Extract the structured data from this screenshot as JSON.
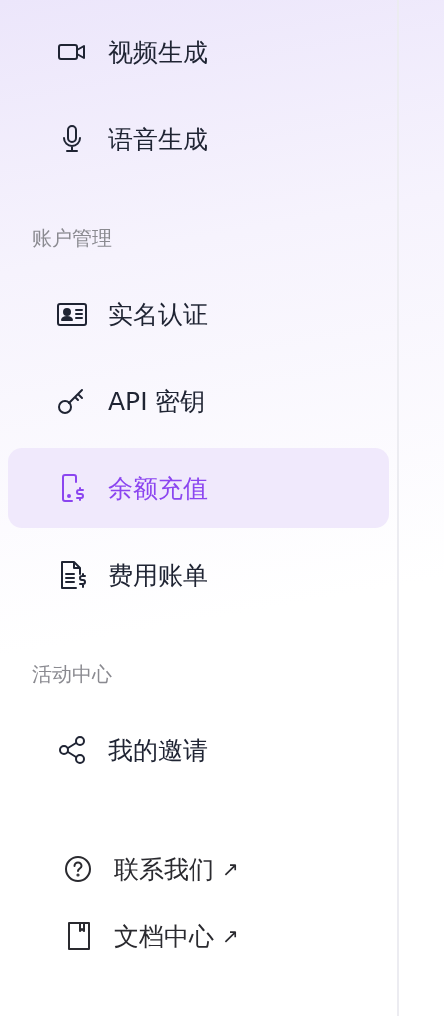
{
  "sidebar": {
    "groups": [
      {
        "items": [
          {
            "label": "视频生成",
            "selected": false
          },
          {
            "label": "语音生成",
            "selected": false
          }
        ]
      },
      {
        "title": "账户管理",
        "items": [
          {
            "label": "实名认证",
            "selected": false
          },
          {
            "label": "API 密钥",
            "selected": false
          },
          {
            "label": "余额充值",
            "selected": true
          },
          {
            "label": "费用账单",
            "selected": false
          }
        ]
      },
      {
        "title": "活动中心",
        "items": [
          {
            "label": "我的邀请",
            "selected": false
          }
        ]
      }
    ],
    "links": [
      {
        "label": "联系我们",
        "arrow": "↗"
      },
      {
        "label": "文档中心",
        "arrow": "↗"
      }
    ]
  }
}
